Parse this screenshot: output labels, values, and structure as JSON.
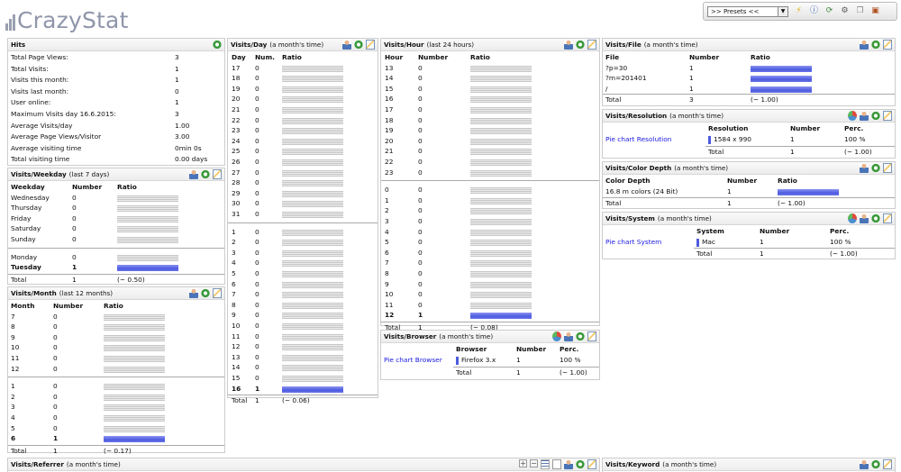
{
  "logo": {
    "text": "CrazyStat"
  },
  "toolbar": {
    "preset": ">> Presets <<"
  },
  "hits": {
    "title": "Hits",
    "rows": [
      [
        "Total Page Views:",
        "3"
      ],
      [
        "Total Visits:",
        "1"
      ],
      [
        "Visits this month:",
        "1"
      ],
      [
        "Visits last month:",
        "0"
      ],
      [
        "User online:",
        "1"
      ],
      [
        "Maximum Visits day 16.6.2015:",
        "3"
      ],
      [
        "Average Visits/day",
        "1.00"
      ],
      [
        "Average Page Views/Visitor",
        "3.00"
      ],
      [
        "Average visiting time",
        "0min 0s"
      ],
      [
        "Total visiting time",
        "0.00 days"
      ]
    ]
  },
  "weekday": {
    "title": "Visits/Weekday",
    "sub": "(last 7 days)",
    "cols": [
      "Weekday",
      "Number",
      "Ratio"
    ],
    "rows": [
      [
        "Wednesday",
        "0",
        0
      ],
      [
        "Thursday",
        "0",
        0
      ],
      [
        "Friday",
        "0",
        0
      ],
      [
        "Saturday",
        "0",
        0
      ],
      [
        "Sunday",
        "0",
        0
      ]
    ],
    "rows2": [
      [
        "Monday",
        "0",
        0
      ],
      [
        "Tuesday",
        "1",
        1
      ]
    ],
    "total": [
      "Total",
      "1",
      "(~ 0.50)"
    ]
  },
  "month": {
    "title": "Visits/Month",
    "sub": "(last 12 months)",
    "cols": [
      "Month",
      "Number",
      "Ratio"
    ],
    "rows": [
      [
        "7",
        "0",
        0
      ],
      [
        "8",
        "0",
        0
      ],
      [
        "9",
        "0",
        0
      ],
      [
        "10",
        "0",
        0
      ],
      [
        "11",
        "0",
        0
      ],
      [
        "12",
        "0",
        0
      ]
    ],
    "rows2": [
      [
        "1",
        "0",
        0
      ],
      [
        "2",
        "0",
        0
      ],
      [
        "3",
        "0",
        0
      ],
      [
        "4",
        "0",
        0
      ],
      [
        "5",
        "0",
        0
      ],
      [
        "6",
        "1",
        1
      ]
    ],
    "total": [
      "Total",
      "1",
      "(~ 0.17)"
    ]
  },
  "day": {
    "title": "Visits/Day",
    "sub": "(a month's time)",
    "cols": [
      "Day",
      "Num.",
      "Ratio"
    ],
    "rows": [
      [
        "17",
        "0",
        0
      ],
      [
        "18",
        "0",
        0
      ],
      [
        "19",
        "0",
        0
      ],
      [
        "20",
        "0",
        0
      ],
      [
        "21",
        "0",
        0
      ],
      [
        "22",
        "0",
        0
      ],
      [
        "23",
        "0",
        0
      ],
      [
        "24",
        "0",
        0
      ],
      [
        "25",
        "0",
        0
      ],
      [
        "26",
        "0",
        0
      ],
      [
        "27",
        "0",
        0
      ],
      [
        "28",
        "0",
        0
      ],
      [
        "29",
        "0",
        0
      ],
      [
        "30",
        "0",
        0
      ],
      [
        "31",
        "0",
        0
      ]
    ],
    "rows2": [
      [
        "1",
        "0",
        0
      ],
      [
        "2",
        "0",
        0
      ],
      [
        "3",
        "0",
        0
      ],
      [
        "4",
        "0",
        0
      ],
      [
        "5",
        "0",
        0
      ],
      [
        "6",
        "0",
        0
      ],
      [
        "7",
        "0",
        0
      ],
      [
        "8",
        "0",
        0
      ],
      [
        "9",
        "0",
        0
      ],
      [
        "10",
        "0",
        0
      ],
      [
        "11",
        "0",
        0
      ],
      [
        "12",
        "0",
        0
      ],
      [
        "13",
        "0",
        0
      ],
      [
        "14",
        "0",
        0
      ],
      [
        "15",
        "0",
        0
      ],
      [
        "16",
        "1",
        1
      ]
    ],
    "total": [
      "Total",
      "1",
      "(~ 0.06)"
    ]
  },
  "hour": {
    "title": "Visits/Hour",
    "sub": "(last 24 hours)",
    "cols": [
      "Hour",
      "Number",
      "Ratio"
    ],
    "rows": [
      [
        "13",
        "0",
        0
      ],
      [
        "14",
        "0",
        0
      ],
      [
        "15",
        "0",
        0
      ],
      [
        "16",
        "0",
        0
      ],
      [
        "17",
        "0",
        0
      ],
      [
        "18",
        "0",
        0
      ],
      [
        "19",
        "0",
        0
      ],
      [
        "20",
        "0",
        0
      ],
      [
        "21",
        "0",
        0
      ],
      [
        "22",
        "0",
        0
      ],
      [
        "23",
        "0",
        0
      ]
    ],
    "rows2": [
      [
        "0",
        "0",
        0
      ],
      [
        "1",
        "0",
        0
      ],
      [
        "2",
        "0",
        0
      ],
      [
        "3",
        "0",
        0
      ],
      [
        "4",
        "0",
        0
      ],
      [
        "5",
        "0",
        0
      ],
      [
        "6",
        "0",
        0
      ],
      [
        "7",
        "0",
        0
      ],
      [
        "8",
        "0",
        0
      ],
      [
        "9",
        "0",
        0
      ],
      [
        "10",
        "0",
        0
      ],
      [
        "11",
        "0",
        0
      ],
      [
        "12",
        "1",
        1
      ]
    ],
    "total": [
      "Total",
      "1",
      "(~ 0.08)"
    ]
  },
  "browser": {
    "title": "Visits/Browser",
    "sub": "(a month's time)",
    "link": "Pie chart Browser",
    "cols": [
      "Browser",
      "Number",
      "Perc."
    ],
    "row": [
      "Firefox 3.x",
      "1",
      "100 %"
    ],
    "total": [
      "Total",
      "1",
      "(~ 1.00)"
    ]
  },
  "file": {
    "title": "Visits/File",
    "sub": "(a month's time)",
    "cols": [
      "File",
      "Number",
      "Ratio"
    ],
    "rows": [
      [
        "?p=30",
        "1",
        1
      ],
      [
        "?m=201401",
        "1",
        1
      ],
      [
        "/",
        "1",
        1
      ]
    ],
    "total": [
      "Total",
      "3",
      "(~ 1.00)"
    ]
  },
  "resolution": {
    "title": "Visits/Resolution",
    "sub": "(a month's time)",
    "link": "Pie chart Resolution",
    "cols": [
      "Resolution",
      "Number",
      "Perc."
    ],
    "row": [
      "1584 x 990",
      "1",
      "100 %"
    ],
    "total": [
      "Total",
      "1",
      "(~ 1.00)"
    ]
  },
  "colordepth": {
    "title": "Visits/Color Depth",
    "sub": "(a month's time)",
    "cols": [
      "Color Depth",
      "Number",
      "Ratio"
    ],
    "row": [
      "16.8 m colors (24 Bit)",
      "1",
      1
    ],
    "total": [
      "Total",
      "1",
      "(~ 1.00)"
    ]
  },
  "system": {
    "title": "Visits/System",
    "sub": "(a month's time)",
    "link": "Pie chart System",
    "cols": [
      "System",
      "Number",
      "Perc."
    ],
    "row": [
      "Mac",
      "1",
      "100 %"
    ],
    "total": [
      "Total",
      "1",
      "(~ 1.00)"
    ]
  },
  "referrer": {
    "title": "Visits/Referrer",
    "sub": "(a month's time)"
  },
  "keyword": {
    "title": "Visits/Keyword",
    "sub": "(a month's time)"
  }
}
